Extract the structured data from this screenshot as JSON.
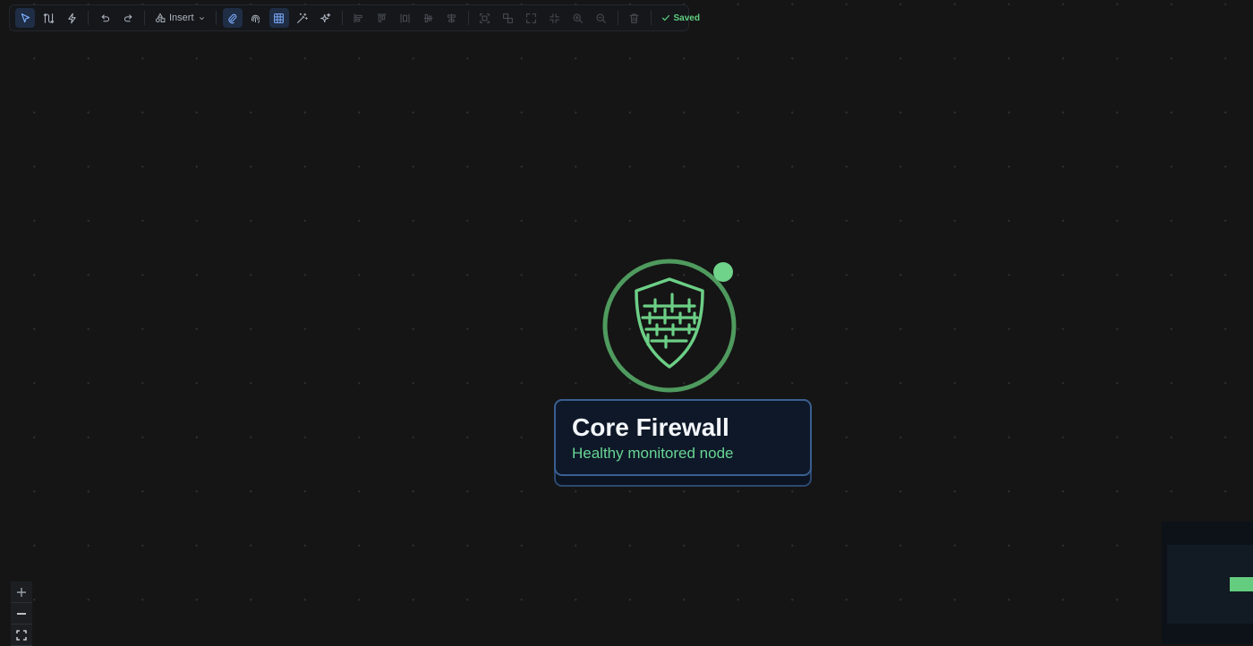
{
  "toolbar": {
    "insert_label": "Insert",
    "status_label": "Saved",
    "tools": [
      {
        "name": "select-tool",
        "icon": "pointer-icon",
        "active": true
      },
      {
        "name": "connect-tool",
        "icon": "route-icon"
      },
      {
        "name": "auto-tool",
        "icon": "lightning-icon"
      },
      {
        "name": "undo",
        "icon": "undo-icon"
      },
      {
        "name": "redo",
        "icon": "redo-icon"
      },
      {
        "name": "link-toggle",
        "icon": "paperclip-icon",
        "active": true
      },
      {
        "name": "fingerprint-toggle",
        "icon": "fingerprint-icon"
      },
      {
        "name": "grid-toggle",
        "icon": "grid-icon",
        "active": true
      },
      {
        "name": "magic-wand",
        "icon": "magic-wand-icon"
      },
      {
        "name": "sparkle",
        "icon": "sparkles-icon"
      },
      {
        "name": "align-left",
        "icon": "align-left-icon",
        "disabled": true
      },
      {
        "name": "align-top",
        "icon": "align-top-icon",
        "disabled": true
      },
      {
        "name": "distribute-horizontal",
        "icon": "distribute-horizontal-icon",
        "disabled": true
      },
      {
        "name": "align-center-vertical",
        "icon": "align-center-vertical-icon",
        "disabled": true
      },
      {
        "name": "align-center-horizontal",
        "icon": "align-center-horizontal-icon",
        "disabled": true
      },
      {
        "name": "group",
        "icon": "group-icon",
        "disabled": true
      },
      {
        "name": "ungroup",
        "icon": "ungroup-icon",
        "disabled": true
      },
      {
        "name": "expand",
        "icon": "expand-icon",
        "disabled": true
      },
      {
        "name": "collapse",
        "icon": "collapse-icon",
        "disabled": true
      },
      {
        "name": "zoom-in",
        "icon": "zoom-in-icon",
        "disabled": true
      },
      {
        "name": "zoom-out",
        "icon": "zoom-out-icon",
        "disabled": true
      },
      {
        "name": "delete",
        "icon": "trash-icon",
        "disabled": true
      }
    ]
  },
  "node": {
    "title": "Core Firewall",
    "subtitle": "Healthy monitored node",
    "icon": "firewall-shield-icon",
    "status": "healthy",
    "status_color": "#6fd38a",
    "accent_color": "#5fb86f",
    "card_border_color": "#3a5f92"
  },
  "zoom_controls": [
    {
      "name": "zoom-in",
      "icon": "plus-icon"
    },
    {
      "name": "zoom-out",
      "icon": "minus-icon"
    },
    {
      "name": "fit-view",
      "icon": "fit-view-icon"
    }
  ],
  "colors": {
    "background": "#151515",
    "toolbar_active": "#1f2d45",
    "saved_green": "#5fcf80"
  }
}
